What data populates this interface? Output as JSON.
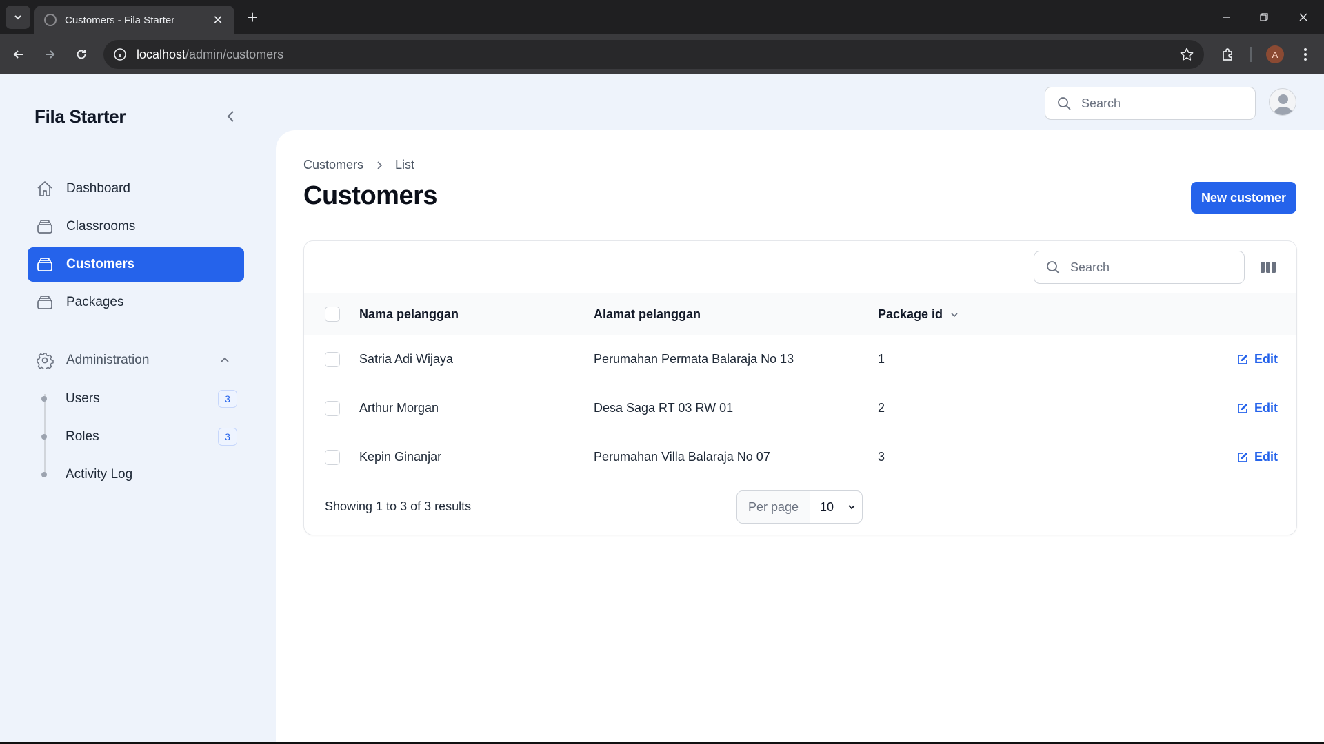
{
  "browser": {
    "tab_title": "Customers - Fila Starter",
    "url_host": "localhost",
    "url_path": "/admin/customers",
    "profile_initial": "A"
  },
  "app": {
    "brand": "Fila Starter",
    "accent_color": "#2563eb"
  },
  "sidebar": {
    "items": [
      {
        "label": "Dashboard",
        "icon": "home-icon"
      },
      {
        "label": "Classrooms",
        "icon": "stack-icon"
      },
      {
        "label": "Customers",
        "icon": "stack-icon",
        "active": true
      },
      {
        "label": "Packages",
        "icon": "stack-icon"
      }
    ],
    "group": {
      "label": "Administration",
      "icon": "gear-icon",
      "expanded": true,
      "items": [
        {
          "label": "Users",
          "badge": "3"
        },
        {
          "label": "Roles",
          "badge": "3"
        },
        {
          "label": "Activity Log"
        }
      ]
    }
  },
  "topbar": {
    "search_placeholder": "Search"
  },
  "page": {
    "breadcrumb": [
      "Customers",
      "List"
    ],
    "title": "Customers",
    "new_button": "New customer"
  },
  "table": {
    "search_placeholder": "Search",
    "columns": [
      "Nama pelanggan",
      "Alamat pelanggan",
      "Package id"
    ],
    "rows": [
      {
        "name": "Satria Adi Wijaya",
        "address": "Perumahan Permata Balaraja No 13",
        "package_id": "1",
        "action": "Edit"
      },
      {
        "name": "Arthur Morgan",
        "address": "Desa Saga RT 03 RW 01",
        "package_id": "2",
        "action": "Edit"
      },
      {
        "name": "Kepin Ginanjar",
        "address": "Perumahan Villa Balaraja No 07",
        "package_id": "3",
        "action": "Edit"
      }
    ],
    "summary": "Showing 1 to 3 of 3 results",
    "per_page_label": "Per page",
    "per_page_value": "10"
  }
}
